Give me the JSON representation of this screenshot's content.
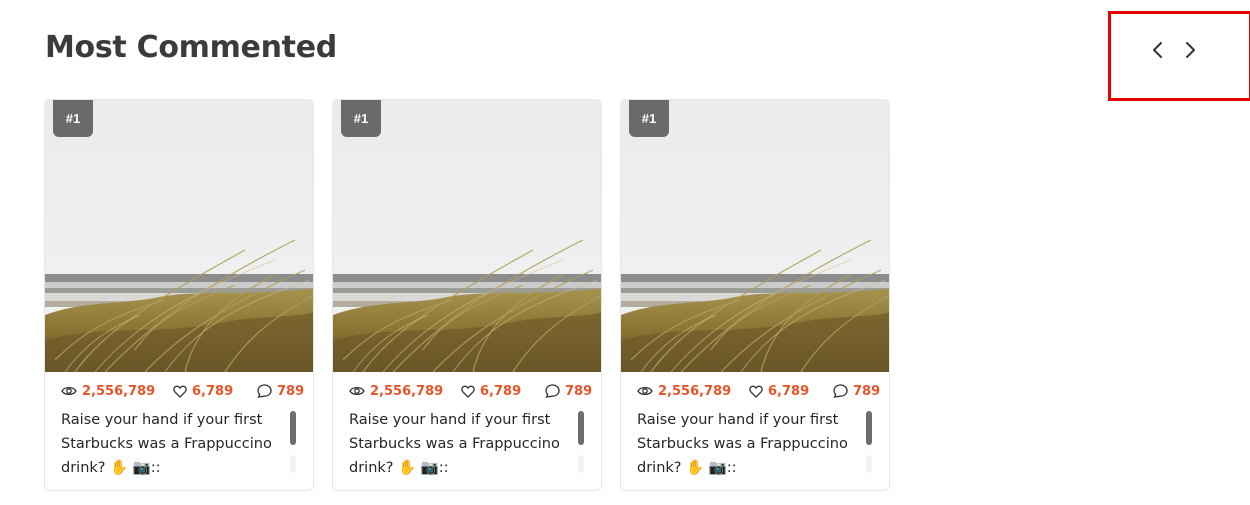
{
  "section": {
    "title": "Most Commented"
  },
  "nav": {
    "prev_icon": "chevron-left-icon",
    "next_icon": "chevron-right-icon"
  },
  "colors": {
    "stat_accent": "#e8542a",
    "rank_badge": "#6a6a6a",
    "highlight": "#e30000"
  },
  "cards": [
    {
      "rank": "#1",
      "views": "2,556,789",
      "likes": "6,789",
      "comments": "789",
      "caption": "Raise your hand if your first Starbucks was a Frappuccino drink? ✋ 📷::"
    },
    {
      "rank": "#1",
      "views": "2,556,789",
      "likes": "6,789",
      "comments": "789",
      "caption": "Raise your hand if your first Starbucks was a Frappuccino drink? ✋ 📷::"
    },
    {
      "rank": "#1",
      "views": "2,556,789",
      "likes": "6,789",
      "comments": "789",
      "caption": "Raise your hand if your first Starbucks was a Frappuccino drink? ✋ 📷::"
    }
  ]
}
